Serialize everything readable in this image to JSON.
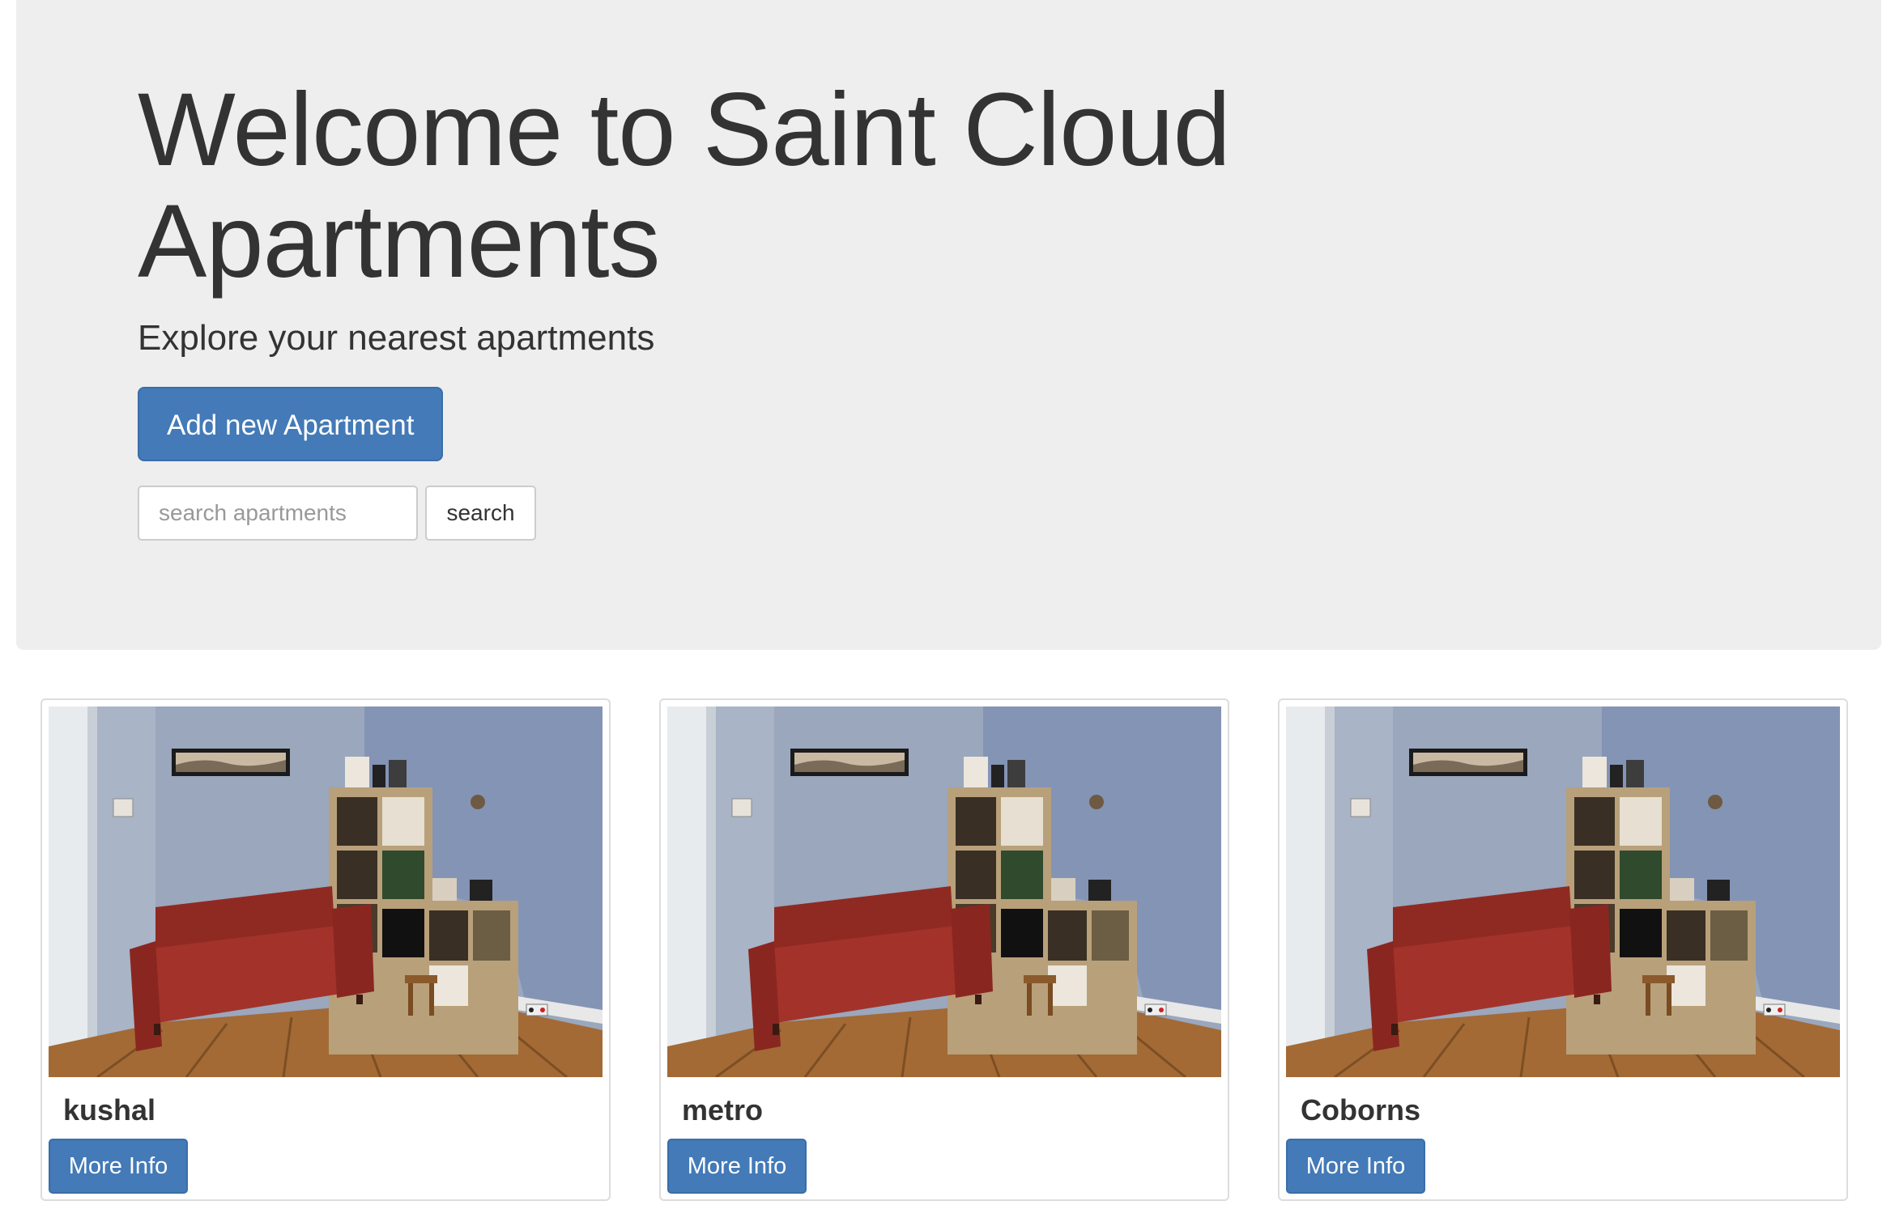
{
  "hero": {
    "title": "Welcome to Saint Cloud Apartments",
    "subtitle": "Explore your nearest apartments",
    "add_button_label": "Add new Apartment",
    "search": {
      "placeholder": "search apartments",
      "value": "",
      "button_label": "search"
    }
  },
  "apartments": [
    {
      "name": "kushal",
      "button_label": "More Info",
      "image": "living-room-photo"
    },
    {
      "name": "metro",
      "button_label": "More Info",
      "image": "living-room-photo"
    },
    {
      "name": "Coborns",
      "button_label": "More Info",
      "image": "living-room-photo"
    }
  ],
  "colors": {
    "primary": "#437ab7",
    "jumbotron_bg": "#eeeeee",
    "text": "#333333"
  }
}
